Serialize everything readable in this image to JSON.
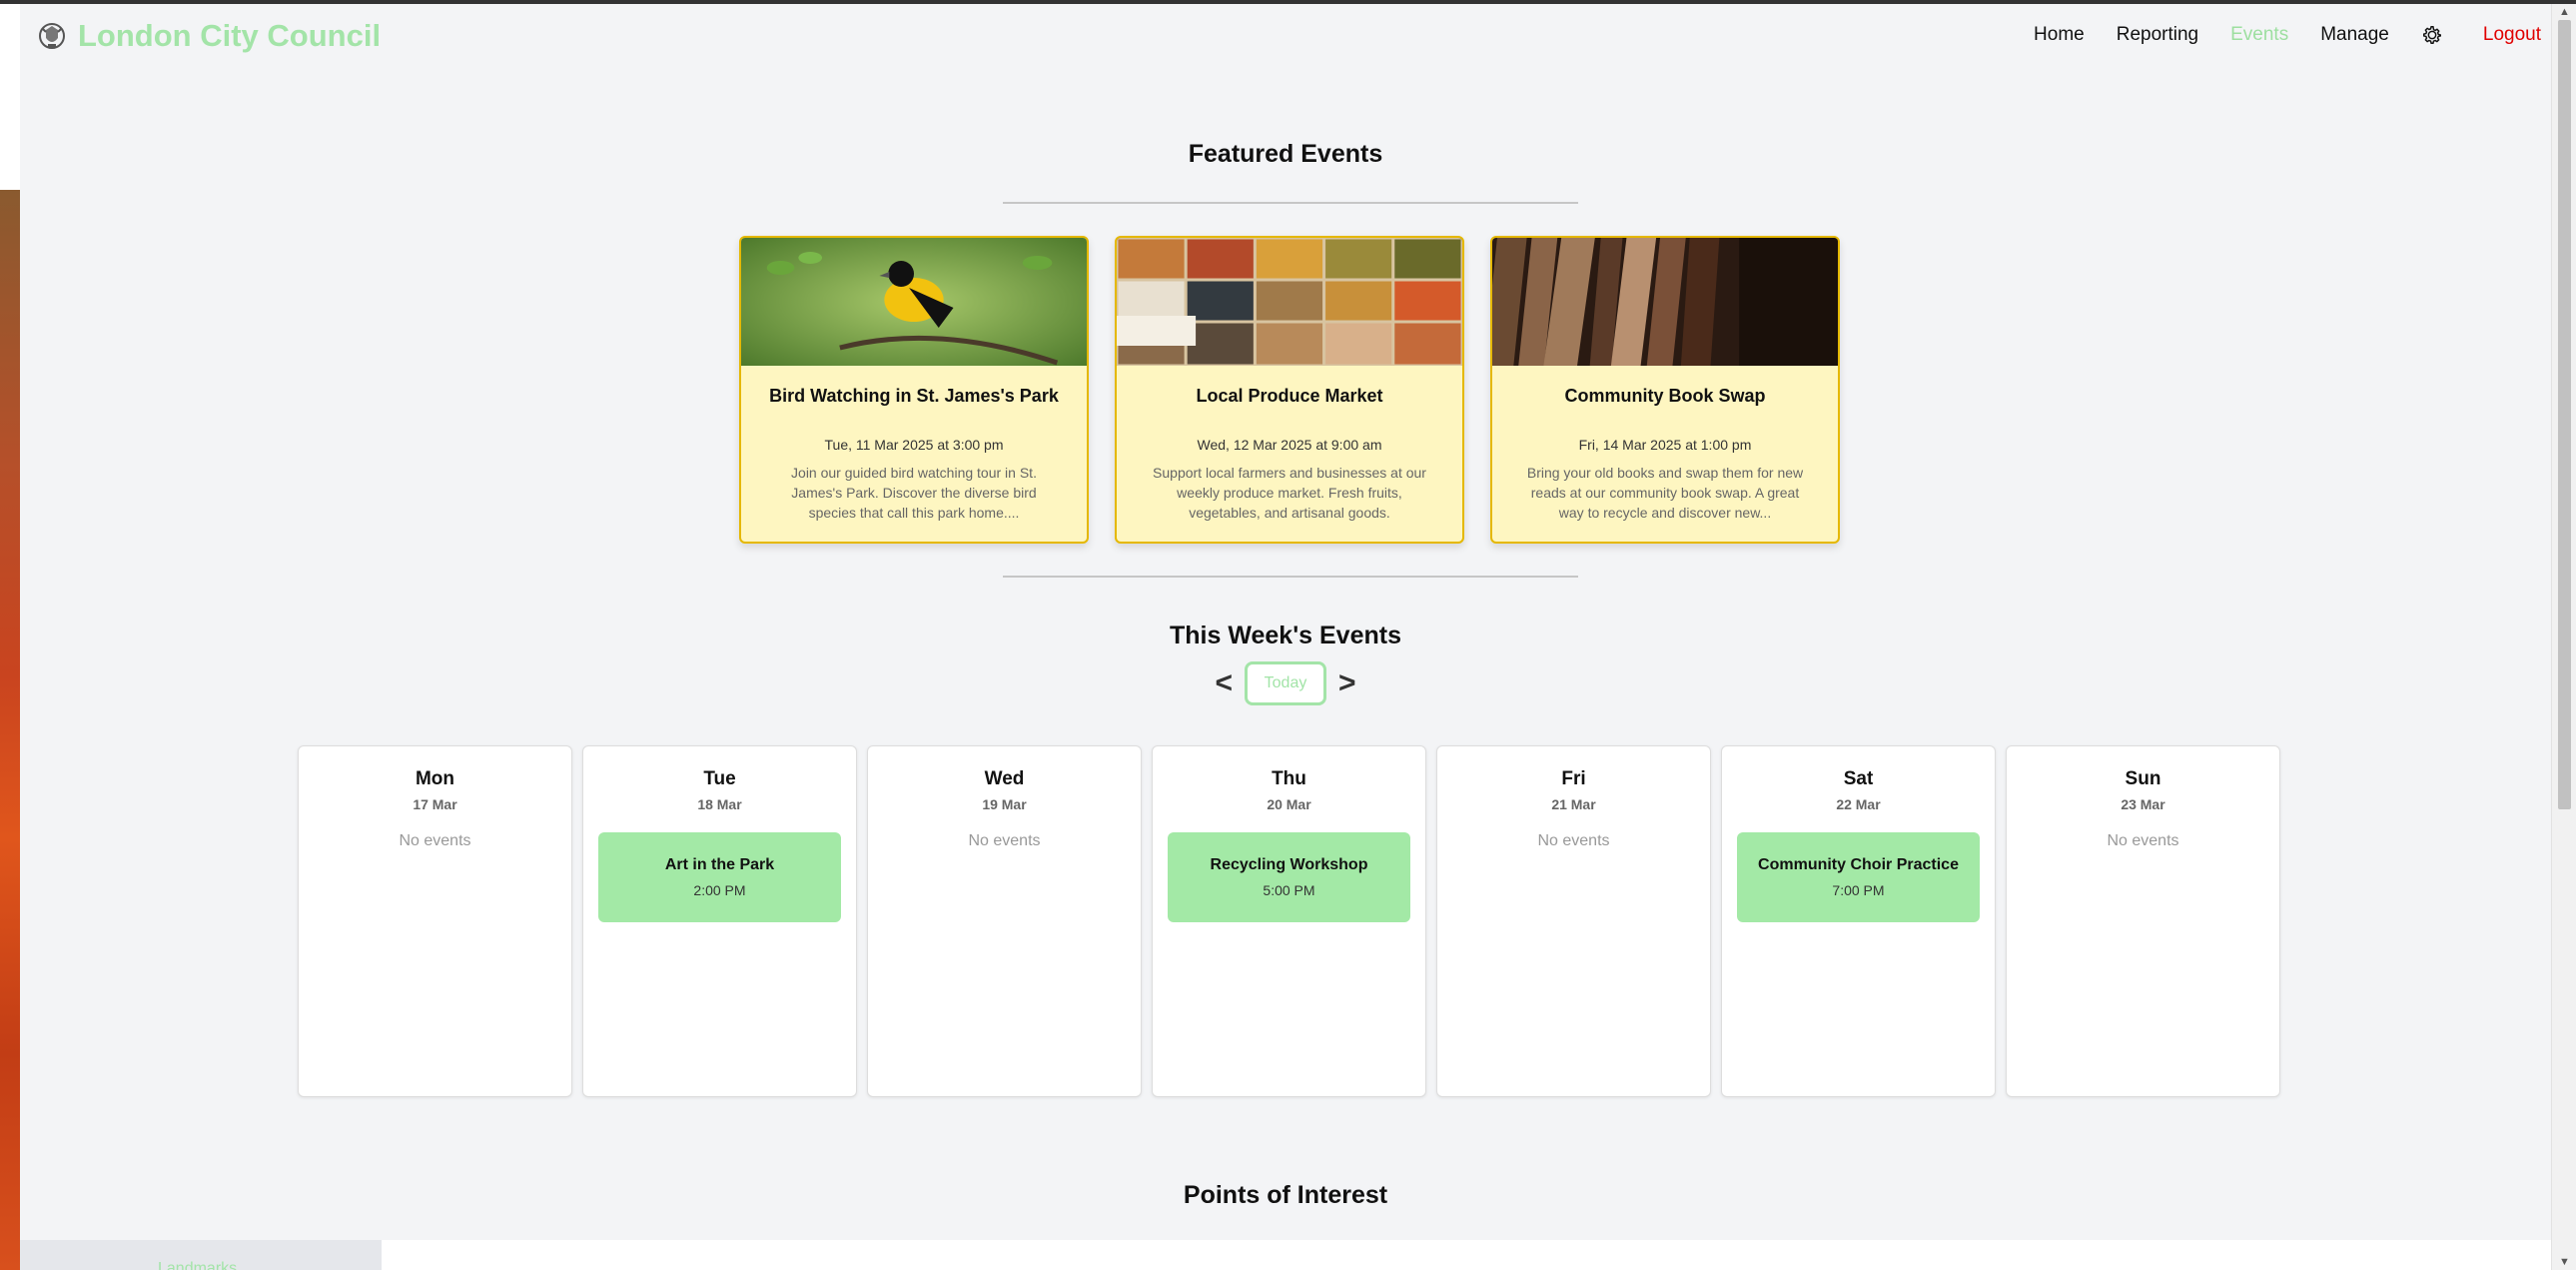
{
  "header": {
    "brand": "London City Council",
    "nav": [
      "Home",
      "Reporting",
      "Events",
      "Manage"
    ],
    "active_nav": "Events",
    "logout": "Logout"
  },
  "featured": {
    "title": "Featured Events",
    "cards": [
      {
        "title": "Bird Watching in St. James's Park",
        "date": "Tue, 11 Mar 2025 at 3:00 pm",
        "desc": "Join our guided bird watching tour in St. James's Park. Discover the diverse bird species that call this park home...."
      },
      {
        "title": "Local Produce Market",
        "date": "Wed, 12 Mar 2025 at 9:00 am",
        "desc": "Support local farmers and businesses at our weekly produce market. Fresh fruits, vegetables, and artisanal goods."
      },
      {
        "title": "Community Book Swap",
        "date": "Fri, 14 Mar 2025 at 1:00 pm",
        "desc": "Bring your old books and swap them for new reads at our community book swap. A great way to recycle and discover new..."
      }
    ]
  },
  "week": {
    "title": "This Week's Events",
    "prev": "<",
    "next": ">",
    "today": "Today",
    "no_events": "No events",
    "days": [
      {
        "name": "Mon",
        "date": "17 Mar",
        "event": null
      },
      {
        "name": "Tue",
        "date": "18 Mar",
        "event": {
          "title": "Art in the Park",
          "time": "2:00 PM"
        }
      },
      {
        "name": "Wed",
        "date": "19 Mar",
        "event": null
      },
      {
        "name": "Thu",
        "date": "20 Mar",
        "event": {
          "title": "Recycling Workshop",
          "time": "5:00 PM"
        }
      },
      {
        "name": "Fri",
        "date": "21 Mar",
        "event": null
      },
      {
        "name": "Sat",
        "date": "22 Mar",
        "event": {
          "title": "Community Choir Practice",
          "time": "7:00 PM"
        }
      },
      {
        "name": "Sun",
        "date": "23 Mar",
        "event": null
      }
    ]
  },
  "poi": {
    "title": "Points of Interest",
    "tab": "Landmarks"
  },
  "colors": {
    "accent_green": "#a3e4a8",
    "event_green": "#a3e9a6",
    "card_yellow": "#fef6c1",
    "card_border": "#e5b800",
    "logout_red": "#e00000"
  }
}
